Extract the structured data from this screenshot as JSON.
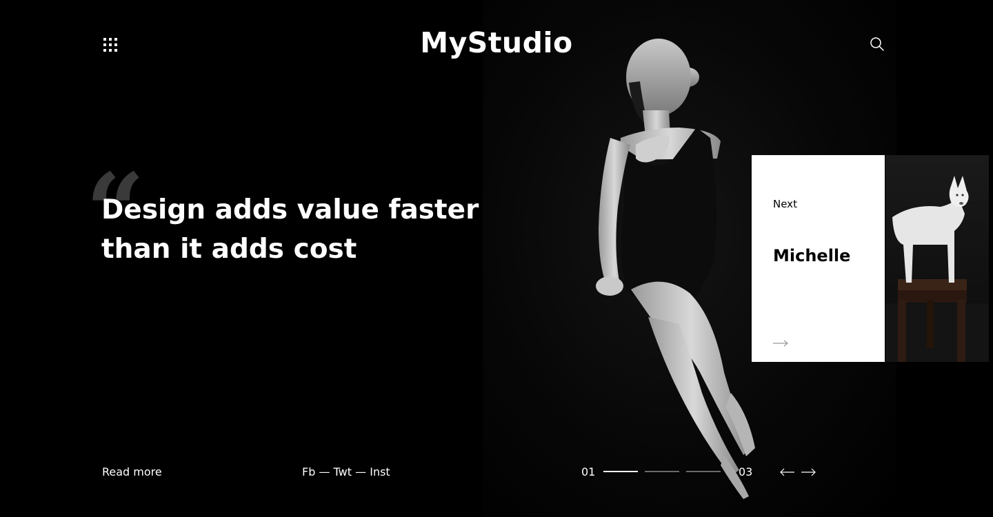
{
  "header": {
    "logo": "MyStudio",
    "menu_icon": "grid-menu-icon",
    "search_icon": "search-icon"
  },
  "hero": {
    "quote_mark": "“",
    "headline_line1": "Design adds value faster",
    "headline_line2": "than it adds cost"
  },
  "next_card": {
    "label": "Next",
    "name": "Michelle",
    "arrow_icon": "arrow-right-icon"
  },
  "footer": {
    "read_more": "Read more",
    "social": [
      "Fb",
      "Twt",
      "Inst"
    ],
    "separator": "—",
    "pager": {
      "start": "01",
      "end": "03",
      "active_index": 0,
      "count": 3
    },
    "prev_icon": "arrow-left-icon",
    "next_icon": "arrow-right-icon"
  },
  "colors": {
    "background": "#000000",
    "text": "#ffffff",
    "quote_mark": "#3a3a3a",
    "pager_inactive": "#6a6a6a",
    "card": "#ffffff"
  }
}
